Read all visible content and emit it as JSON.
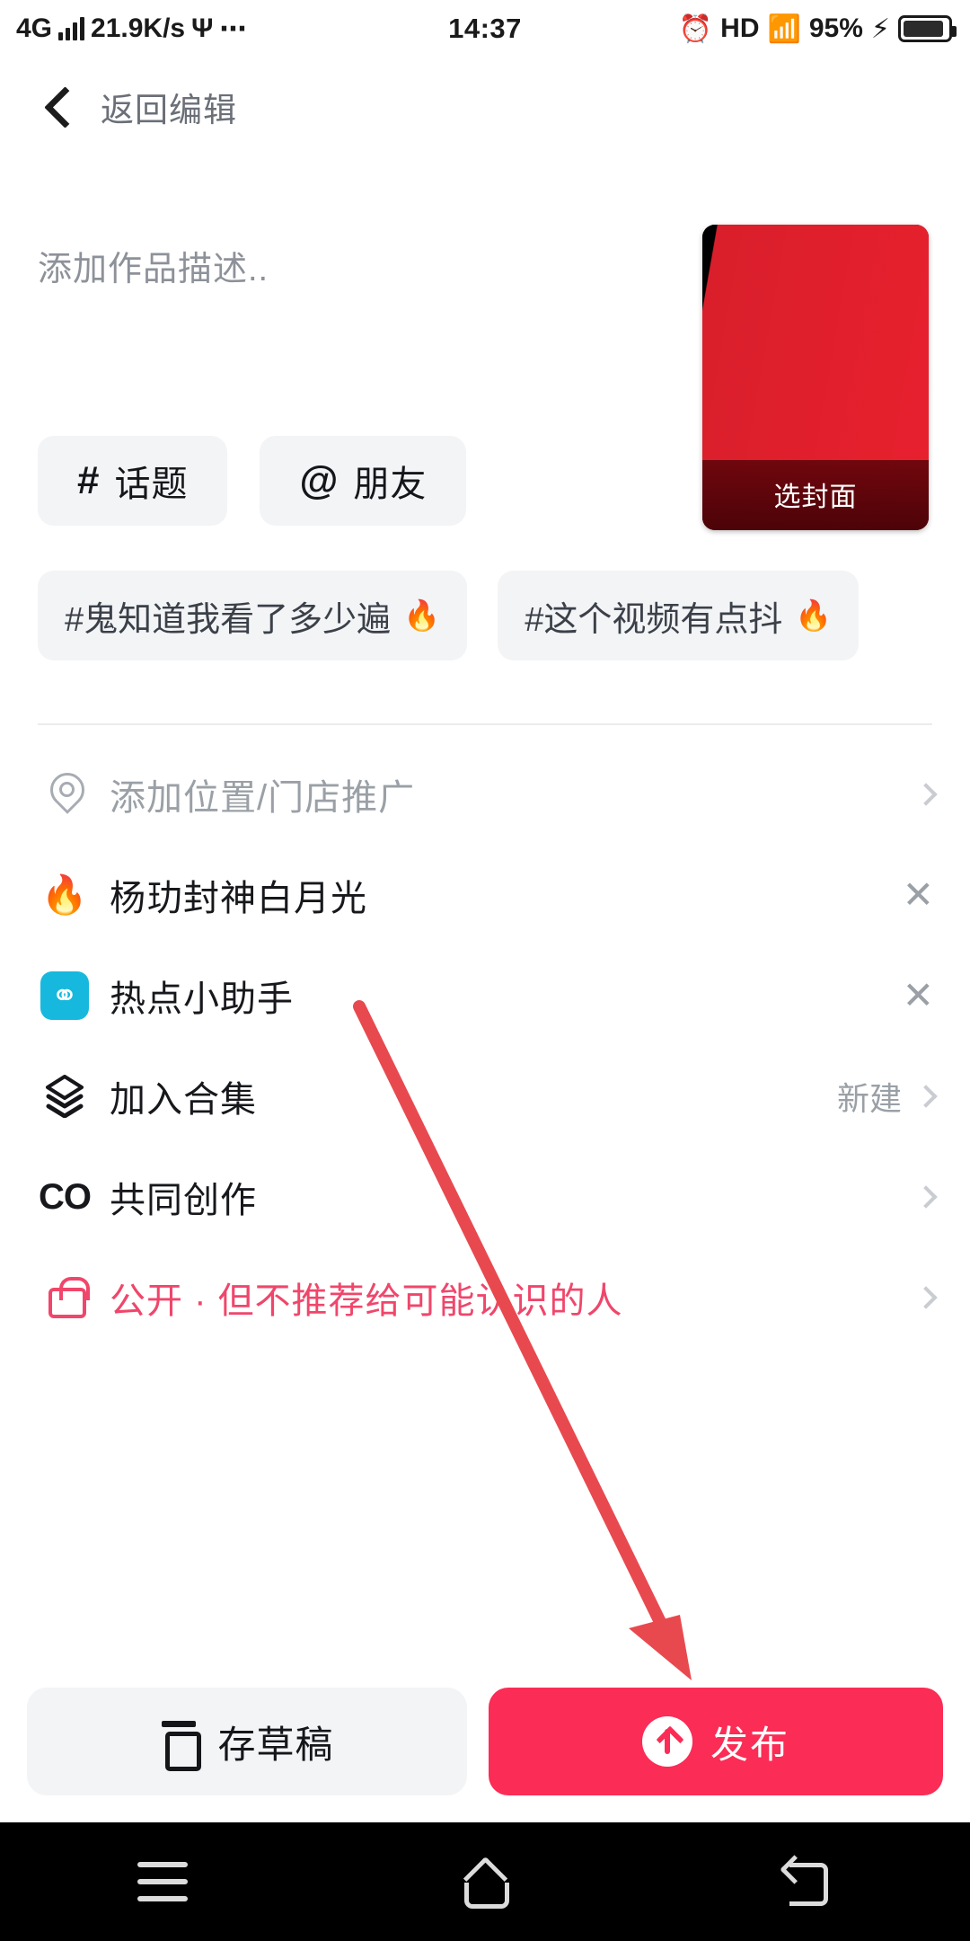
{
  "status_bar": {
    "network_type": "4G",
    "speed": "21.9K/s",
    "usb_icon": "usb-icon",
    "more_icon": "ellipsis-icon",
    "time": "14:37",
    "alarm_icon": "alarm-icon",
    "hd_label": "HD",
    "wifi_icon": "wifi-icon",
    "battery_percent": "95%",
    "charging_icon": "lightning-icon"
  },
  "header": {
    "back_icon": "chevron-left-icon",
    "title": "返回编辑"
  },
  "description": {
    "placeholder": "添加作品描述..",
    "value": ""
  },
  "cover": {
    "label": "选封面",
    "color": "#e01f2c"
  },
  "insert_chips": [
    {
      "symbol": "#",
      "label": "话题",
      "name": "topic-chip"
    },
    {
      "symbol": "@",
      "label": "朋友",
      "name": "friend-chip"
    }
  ],
  "suggested_tags": [
    {
      "label": "#鬼知道我看了多少遍",
      "hot_icon": "fire-icon"
    },
    {
      "label": "#这个视频有点抖",
      "hot_icon": "fire-icon"
    }
  ],
  "rows": [
    {
      "icon": "location-pin-icon",
      "label": "添加位置/门店推广",
      "style": "muted",
      "value": "",
      "trailing": "chevron"
    },
    {
      "icon": "fire-icon",
      "label": "杨玏封神白月光",
      "style": "normal",
      "value": "",
      "trailing": "close"
    },
    {
      "icon": "hot-assistant-icon",
      "label": "热点小助手",
      "style": "normal",
      "value": "",
      "trailing": "close"
    },
    {
      "icon": "layers-icon",
      "label": "加入合集",
      "style": "normal",
      "value": "新建",
      "trailing": "chevron"
    },
    {
      "icon": "co-create-icon",
      "label": "共同创作",
      "style": "normal",
      "value": "",
      "trailing": "chevron"
    },
    {
      "icon": "unlock-icon",
      "label": "公开 · 但不推荐给可能认识的人",
      "style": "pink",
      "value": "",
      "trailing": "chevron"
    }
  ],
  "footer": {
    "draft_label": "存草稿",
    "draft_icon": "draft-box-icon",
    "publish_label": "发布",
    "publish_icon": "upload-circle-icon",
    "publish_color": "#fb2c55"
  },
  "nav_bar": {
    "menu_icon": "menu-icon",
    "home_icon": "home-icon",
    "back_icon": "back-icon"
  },
  "annotation": {
    "arrow_color": "#e8494f",
    "description": "red arrow pointing to publish button"
  }
}
